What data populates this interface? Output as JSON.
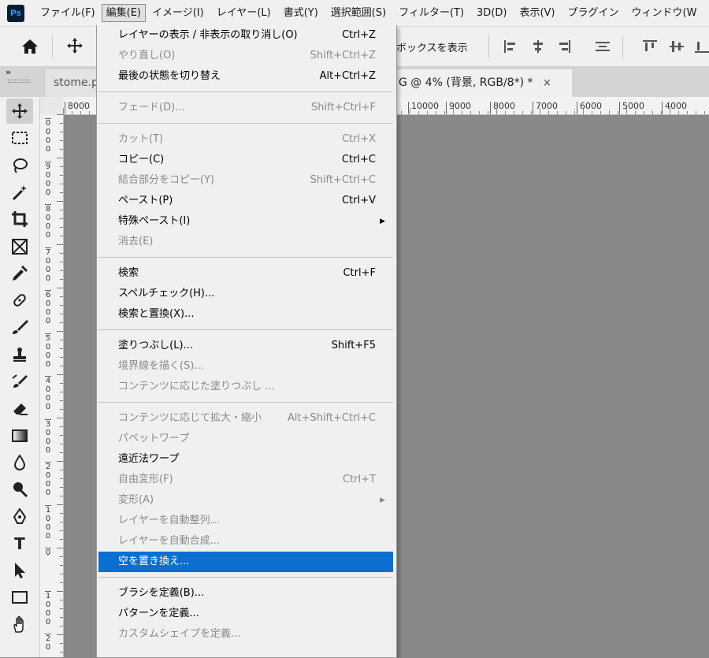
{
  "app": {
    "logo": "Ps"
  },
  "menubar": {
    "items": [
      {
        "label": "ファイル(F)",
        "active": false
      },
      {
        "label": "編集(E)",
        "active": true
      },
      {
        "label": "イメージ(I)",
        "active": false
      },
      {
        "label": "レイヤー(L)",
        "active": false
      },
      {
        "label": "書式(Y)",
        "active": false
      },
      {
        "label": "選択範囲(S)",
        "active": false
      },
      {
        "label": "フィルター(T)",
        "active": false
      },
      {
        "label": "3D(D)",
        "active": false
      },
      {
        "label": "表示(V)",
        "active": false
      },
      {
        "label": "プラグイン",
        "active": false
      },
      {
        "label": "ウィンドウ(W",
        "active": false
      }
    ]
  },
  "options": {
    "show_transform_box": "ボックスを表示"
  },
  "tabs": {
    "collapse": "»",
    "inactive_label": "stome.p",
    "active_label": "G @ 4% (背景, RGB/8*) *",
    "close": "×"
  },
  "ruler": {
    "top_labels": [
      "8000",
      "10000",
      "9000",
      "8000",
      "7000",
      "6000",
      "5000",
      "4000"
    ],
    "left_labels": [
      {
        "text": "0\n0\n0\n0"
      },
      {
        "text": "9\n0\n0\n0"
      },
      {
        "text": "8\n0\n0\n0"
      },
      {
        "text": "7\n0\n0\n0"
      },
      {
        "text": "6\n0\n0\n0"
      },
      {
        "text": "5\n0\n0\n0"
      },
      {
        "text": "4\n0\n0\n0"
      },
      {
        "text": "3\n0\n0\n0"
      },
      {
        "text": "2\n0\n0\n0"
      },
      {
        "text": "1\n0\n0\n0"
      },
      {
        "text": "0"
      },
      {
        "text": "1\n0\n0\n0"
      },
      {
        "text": "2\n0"
      }
    ]
  },
  "toolbar": {
    "tools": [
      {
        "name": "move-tool-icon",
        "selected": true
      },
      {
        "name": "marquee-tool-icon",
        "selected": false
      },
      {
        "name": "lasso-tool-icon",
        "selected": false
      },
      {
        "name": "magic-wand-tool-icon",
        "selected": false
      },
      {
        "name": "crop-tool-icon",
        "selected": false
      },
      {
        "name": "frame-tool-icon",
        "selected": false
      },
      {
        "name": "eyedropper-tool-icon",
        "selected": false
      },
      {
        "name": "healing-brush-tool-icon",
        "selected": false
      },
      {
        "name": "brush-tool-icon",
        "selected": false
      },
      {
        "name": "clone-stamp-tool-icon",
        "selected": false
      },
      {
        "name": "history-brush-tool-icon",
        "selected": false
      },
      {
        "name": "eraser-tool-icon",
        "selected": false
      },
      {
        "name": "gradient-tool-icon",
        "selected": false
      },
      {
        "name": "blur-tool-icon",
        "selected": false
      },
      {
        "name": "dodge-tool-icon",
        "selected": false
      },
      {
        "name": "pen-tool-icon",
        "selected": false
      },
      {
        "name": "type-tool-icon",
        "selected": false
      },
      {
        "name": "path-selection-tool-icon",
        "selected": false
      },
      {
        "name": "rectangle-tool-icon",
        "selected": false
      },
      {
        "name": "hand-tool-icon",
        "selected": false
      }
    ],
    "type_glyph": "T"
  },
  "edit_menu": {
    "items": [
      {
        "label": "レイヤーの表示 / 非表示の取り消し(O)",
        "shortcut": "Ctrl+Z",
        "disabled": false
      },
      {
        "label": "やり直し(O)",
        "shortcut": "Shift+Ctrl+Z",
        "disabled": true
      },
      {
        "label": "最後の状態を切り替え",
        "shortcut": "Alt+Ctrl+Z",
        "disabled": false
      },
      {
        "separator": true
      },
      {
        "label": "フェード(D)...",
        "shortcut": "Shift+Ctrl+F",
        "disabled": true
      },
      {
        "separator": true
      },
      {
        "label": "カット(T)",
        "shortcut": "Ctrl+X",
        "disabled": true
      },
      {
        "label": "コピー(C)",
        "shortcut": "Ctrl+C",
        "disabled": false
      },
      {
        "label": "結合部分をコピー(Y)",
        "shortcut": "Shift+Ctrl+C",
        "disabled": true
      },
      {
        "label": "ペースト(P)",
        "shortcut": "Ctrl+V",
        "disabled": false
      },
      {
        "label": "特殊ペースト(I)",
        "shortcut": "",
        "disabled": false,
        "submenu": true
      },
      {
        "label": "消去(E)",
        "shortcut": "",
        "disabled": true
      },
      {
        "separator": true
      },
      {
        "label": "検索",
        "shortcut": "Ctrl+F",
        "disabled": false
      },
      {
        "label": "スペルチェック(H)...",
        "shortcut": "",
        "disabled": false
      },
      {
        "label": "検索と置換(X)...",
        "shortcut": "",
        "disabled": false
      },
      {
        "separator": true
      },
      {
        "label": "塗りつぶし(L)...",
        "shortcut": "Shift+F5",
        "disabled": false
      },
      {
        "label": "境界線を描く(S)...",
        "shortcut": "",
        "disabled": true
      },
      {
        "label": "コンテンツに応じた塗りつぶし ...",
        "shortcut": "",
        "disabled": true
      },
      {
        "separator": true
      },
      {
        "label": "コンテンツに応じて拡大・縮小",
        "shortcut": "Alt+Shift+Ctrl+C",
        "disabled": true
      },
      {
        "label": "パペットワープ",
        "shortcut": "",
        "disabled": true
      },
      {
        "label": "遠近法ワープ",
        "shortcut": "",
        "disabled": false
      },
      {
        "label": "自由変形(F)",
        "shortcut": "Ctrl+T",
        "disabled": true
      },
      {
        "label": "変形(A)",
        "shortcut": "",
        "disabled": true,
        "submenu": true
      },
      {
        "label": "レイヤーを自動整列...",
        "shortcut": "",
        "disabled": true
      },
      {
        "label": "レイヤーを自動合成...",
        "shortcut": "",
        "disabled": true
      },
      {
        "label": "空を置き換え...",
        "shortcut": "",
        "disabled": false,
        "highlighted": true
      },
      {
        "separator": true
      },
      {
        "label": "ブラシを定義(B)...",
        "shortcut": "",
        "disabled": false
      },
      {
        "label": "パターンを定義...",
        "shortcut": "",
        "disabled": false
      },
      {
        "label": "カスタムシェイプを定義...",
        "shortcut": "",
        "disabled": true
      }
    ]
  },
  "colors": {
    "highlight": "#0a6fd1",
    "canvas": "#888888",
    "disabled_text": "#8a8a8a",
    "logo_bg": "#001e36",
    "logo_fg": "#31a8ff"
  }
}
